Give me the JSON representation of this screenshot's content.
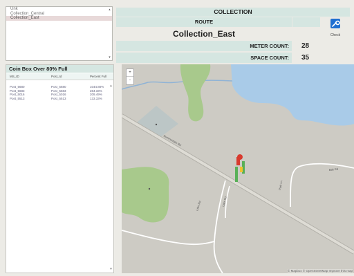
{
  "routes": {
    "items": [
      {
        "label": "Unk",
        "selected": false
      },
      {
        "label": "Collection_Central",
        "selected": false
      },
      {
        "label": "Collection_East",
        "selected": true
      }
    ]
  },
  "header": {
    "collection_label": "COLLECTION",
    "route_label": "ROUTE",
    "route_name": "Collection_East",
    "meter_count_label": "METER COUNT:",
    "meter_count_value": "28",
    "space_count_label": "SPACE COUNT:",
    "space_count_value": "35",
    "check_label": "Check"
  },
  "coin_box": {
    "title": "Coin Box Over 80% Full",
    "columns": [
      "MS_ID",
      "Post_Id",
      "Percent Full"
    ],
    "rows": [
      [
        "Post_5680",
        "Post_5680",
        "1044.80%"
      ],
      [
        "Post_5683",
        "Post_5683",
        "284.33%"
      ],
      [
        "Post_5016",
        "Post_5016",
        "209.49%"
      ],
      [
        "Post_5513",
        "Post_5513",
        "133.33%"
      ]
    ]
  },
  "map": {
    "zoom_in": "+",
    "zoom_out": "-",
    "attribution": "© Mapbox © OpenStreetMap Improve this map",
    "road_labels": [
      "Summerdale Rd",
      "Lake Rd",
      "Lake Rd",
      "Park Ln",
      "Bak Rd"
    ],
    "colors": {
      "water": "#a9cbe8",
      "park": "#a8c98c",
      "land": "#cdcbc4",
      "road": "#ffffff",
      "marker_red": "#d83a2e",
      "marker_green": "#58b058"
    }
  }
}
